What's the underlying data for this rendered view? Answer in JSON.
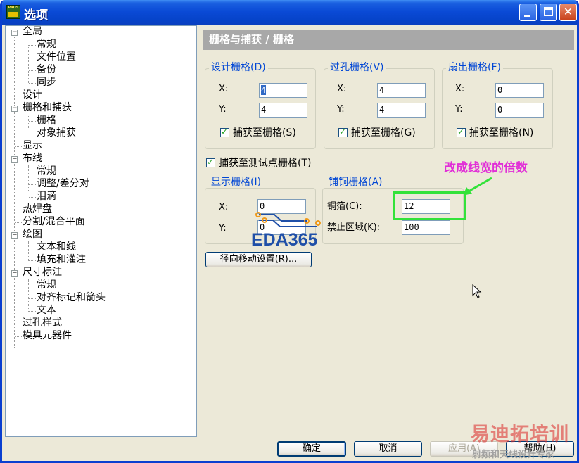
{
  "window": {
    "title": "选项",
    "app_icon_text": "PADS",
    "minimize": "_",
    "maximize": "",
    "close": "✕"
  },
  "tree": {
    "items": [
      {
        "label": "全局"
      },
      {
        "label": "常规"
      },
      {
        "label": "文件位置"
      },
      {
        "label": "备份"
      },
      {
        "label": "同步"
      },
      {
        "label": "设计"
      },
      {
        "label": "栅格和捕获"
      },
      {
        "label": "栅格"
      },
      {
        "label": "对象捕获"
      },
      {
        "label": "显示"
      },
      {
        "label": "布线"
      },
      {
        "label": "常规"
      },
      {
        "label": "调整/差分对"
      },
      {
        "label": "泪滴"
      },
      {
        "label": "热焊盘"
      },
      {
        "label": "分割/混合平面"
      },
      {
        "label": "绘图"
      },
      {
        "label": "文本和线"
      },
      {
        "label": "填充和灌注"
      },
      {
        "label": "尺寸标注"
      },
      {
        "label": "常规"
      },
      {
        "label": "对齐标记和箭头"
      },
      {
        "label": "文本"
      },
      {
        "label": "过孔样式"
      },
      {
        "label": "模具元器件"
      }
    ],
    "expander_symbol": "−"
  },
  "panel": {
    "header": "栅格与捕获 / 栅格",
    "design_grid": {
      "label": "设计栅格(D)",
      "x_label": "X:",
      "y_label": "Y:",
      "x": "4",
      "y": "4",
      "snap_label": "捕获至栅格(S)",
      "snap_checked": true
    },
    "via_grid": {
      "label": "过孔栅格(V)",
      "x_label": "X:",
      "y_label": "Y:",
      "x": "4",
      "y": "4",
      "snap_label": "捕获至栅格(G)",
      "snap_checked": true
    },
    "fanout_grid": {
      "label": "扇出栅格(F)",
      "x_label": "X:",
      "y_label": "Y:",
      "x": "0",
      "y": "0",
      "snap_label": "捕获至栅格(N)",
      "snap_checked": true
    },
    "test_point_snap": {
      "label": "捕获至测试点栅格(T)",
      "checked": true
    },
    "display_grid": {
      "label": "显示栅格(I)",
      "x_label": "X:",
      "y_label": "Y:",
      "x": "0",
      "y": "0"
    },
    "copper_grid": {
      "label": "铺铜栅格(A)",
      "copper_label": "铜箔(C):",
      "copper_value": "12",
      "keepout_label": "禁止区域(K):",
      "keepout_value": "100"
    },
    "radial_button": "径向移动设置(R)..."
  },
  "buttons": {
    "ok": "确定",
    "cancel": "取消",
    "apply": "应用(A)",
    "help": "帮助(H)"
  },
  "annotation": {
    "text": "改成线宽的倍数",
    "color": "#e12fd7",
    "box_color": "#33e23a"
  },
  "watermarks": {
    "eda": "EDA365",
    "site_line1": "易迪拓培训",
    "site_line2": "射频和天线设计专家"
  }
}
